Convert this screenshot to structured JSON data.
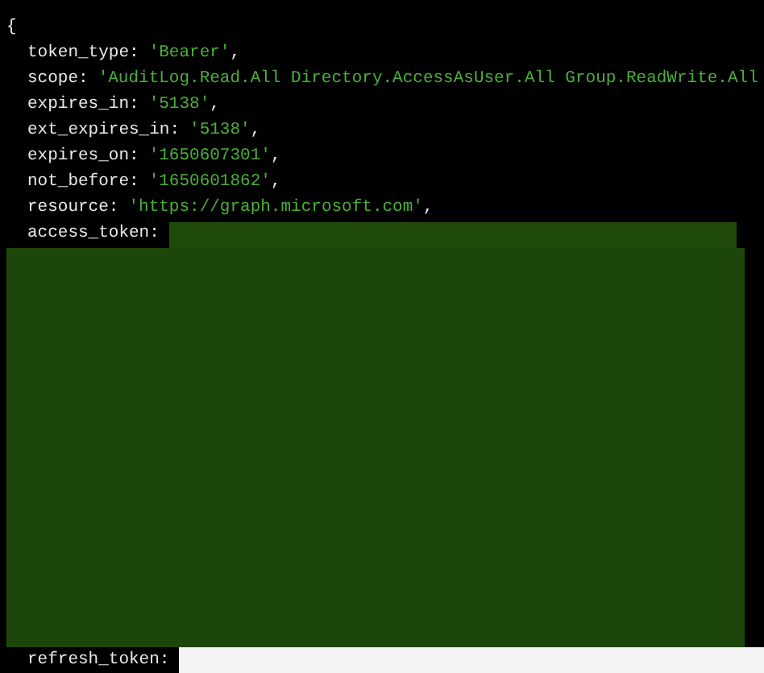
{
  "open_brace": "{",
  "fields": [
    {
      "kind": "text",
      "key": "token_type:",
      "value": "'Bearer'",
      "punct": ","
    },
    {
      "kind": "text",
      "key": "scope:",
      "value": "'AuditLog.Read.All Directory.AccessAsUser.All Group.ReadWrite.All"
    },
    {
      "kind": "text",
      "key": "expires_in:",
      "value": "'5138'",
      "punct": ","
    },
    {
      "kind": "text",
      "key": "ext_expires_in:",
      "value": "'5138'",
      "punct": ","
    },
    {
      "kind": "text",
      "key": "expires_on:",
      "value": "'1650607301'",
      "punct": ","
    },
    {
      "kind": "text",
      "key": "not_before:",
      "value": "'1650601862'",
      "punct": ","
    },
    {
      "kind": "text",
      "key": "resource:",
      "value": "'https://graph.microsoft.com'",
      "punct": ","
    },
    {
      "kind": "redacted",
      "key": "access_token:"
    },
    {
      "kind": "redacted_end",
      "key": "refresh_token:"
    }
  ]
}
